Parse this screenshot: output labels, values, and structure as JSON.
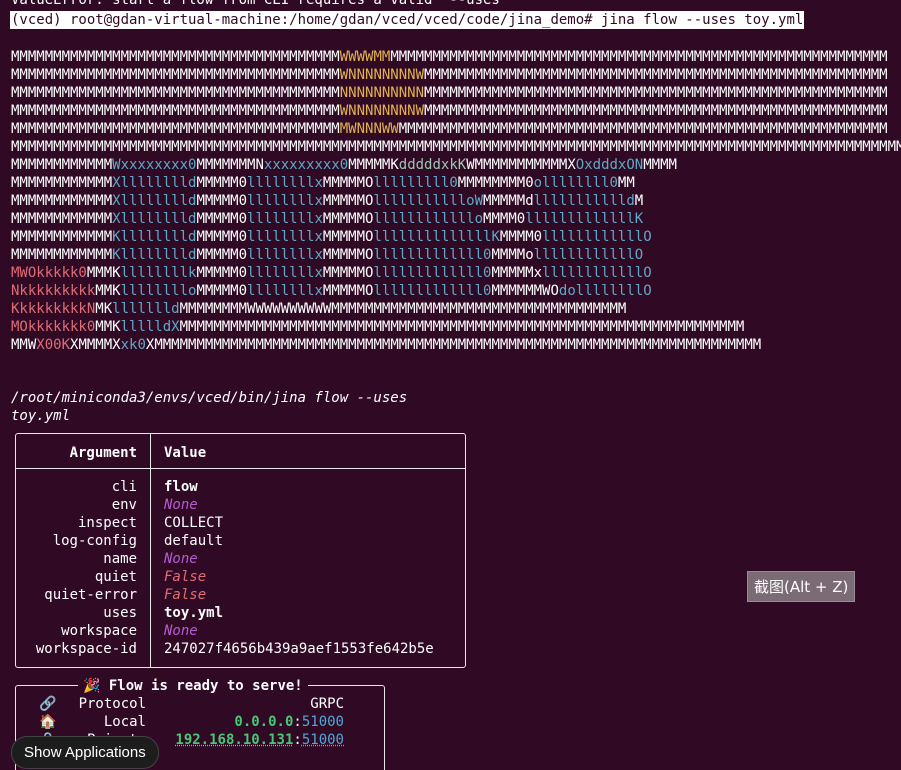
{
  "terminal": {
    "cut_line": "ValueError: start a flow from CLI requires a valid  --uses",
    "prompt": "(vced) root@gdan-virtual-machine:/home/gdan/vced/vced/code/jina_demo# jina flow --uses toy.yml",
    "ascii_art": [
      [
        [
          "w",
          "MMMMMMMMMMMMMMMMMMMMMMMMMMMMMMMMMMMMMMM"
        ],
        [
          "y",
          "WWWWMM"
        ],
        [
          "w",
          "MMMMMMMMMMMMMMMMMMMMMMMMMMMMMMMMMMMMMMMMMMMMMMMMMMMMMMMMMMM"
        ]
      ],
      [
        [
          "w",
          "MMMMMMMMMMMMMMMMMMMMMMMMMMMMMMMMMMMMMMM"
        ],
        [
          "y",
          "WNNNNNNNNW"
        ],
        [
          "w",
          "MMMMMMMMMMMMMMMMMMMMMMMMMMMMMMMMMMMMMMMMMMMMMMMMMMMMMMM"
        ]
      ],
      [
        [
          "w",
          "MMMMMMMMMMMMMMMMMMMMMMMMMMMMMMMMMMMMMMM"
        ],
        [
          "y",
          "NNNNNNNNNN"
        ],
        [
          "w",
          "MMMMMMMMMMMMMMMMMMMMMMMMMMMMMMMMMMMMMMMMMMMMMMMMMMMMMMM"
        ]
      ],
      [
        [
          "w",
          "MMMMMMMMMMMMMMMMMMMMMMMMMMMMMMMMMMMMMMM"
        ],
        [
          "y",
          "WNNNNNNNNW"
        ],
        [
          "w",
          "MMMMMMMMMMMMMMMMMMMMMMMMMMMMMMMMMMMMMMMMMMMMMMMMMMMMMMM"
        ]
      ],
      [
        [
          "w",
          "MMMMMMMMMMMMMMMMMMMMMMMMMMMMMMMMMMMMMMM"
        ],
        [
          "y",
          "MWNNNWW"
        ],
        [
          "w",
          "MMMMMMMMMMMMMMMMMMMMMMMMMMMMMMMMMMMMMMMMMMMMMMMMMMMMMMMMMM"
        ]
      ],
      [
        [
          "w",
          "MMMMMMMMMMMMMMMMMMMMMMMMMMMMMMMMMMMMMMMMMMMMMMMMMMMMMMMMMMMMMMMMMMMMMMMMMMMMMMMMMMMMMMMMMMMMMMMMMMMMMMMMMMMM"
        ]
      ],
      [
        [
          "w",
          "MMMMMMMMMMMM"
        ],
        [
          "c",
          "Wxxxxxxxx0"
        ],
        [
          "w",
          "MMMMMMMN"
        ],
        [
          "c",
          "xxxxxxxxx0"
        ],
        [
          "w",
          "MMMMMK"
        ],
        [
          "g",
          "dddddxkK"
        ],
        [
          "w",
          "WMMMMMMMMMMMX"
        ],
        [
          "c",
          "OxdddxON"
        ],
        [
          "w",
          "MMMM"
        ]
      ],
      [
        [
          "w",
          "MMMMMMMMMMMM"
        ],
        [
          "c",
          "Xlllllllld"
        ],
        [
          "w",
          "MMMMM0"
        ],
        [
          "c",
          "llllllllx"
        ],
        [
          "w",
          "MMMMMO"
        ],
        [
          "c",
          "lllllllll0"
        ],
        [
          "w",
          "MMMMMMMM0"
        ],
        [
          "c",
          "ollllllll0"
        ],
        [
          "w",
          "MM"
        ]
      ],
      [
        [
          "w",
          "MMMMMMMMMMMM"
        ],
        [
          "c",
          "Xlllllllld"
        ],
        [
          "w",
          "MMMMM0"
        ],
        [
          "c",
          "llllllllx"
        ],
        [
          "w",
          "MMMMMO"
        ],
        [
          "c",
          "llllllllllloW"
        ],
        [
          "w",
          "MMMMMd"
        ],
        [
          "c",
          "llllllllllld"
        ],
        [
          "w",
          "M"
        ]
      ],
      [
        [
          "w",
          "MMMMMMMMMMMM"
        ],
        [
          "c",
          "Xlllllllld"
        ],
        [
          "w",
          "MMMMM0"
        ],
        [
          "c",
          "llllllllx"
        ],
        [
          "w",
          "MMMMMO"
        ],
        [
          "c",
          "llllllllllllo"
        ],
        [
          "w",
          "MMMM0"
        ],
        [
          "c",
          "lllllllllllllK"
        ]
      ],
      [
        [
          "w",
          "MMMMMMMMMMMM"
        ],
        [
          "c",
          "Klllllllld"
        ],
        [
          "w",
          "MMMMM0"
        ],
        [
          "c",
          "llllllllx"
        ],
        [
          "w",
          "MMMMMO"
        ],
        [
          "c",
          "llllllllllllllK"
        ],
        [
          "w",
          "MMMM0"
        ],
        [
          "c",
          "llllllllllllO"
        ]
      ],
      [
        [
          "w",
          "MMMMMMMMMMMM"
        ],
        [
          "c",
          "Klllllllld"
        ],
        [
          "w",
          "MMMMM0"
        ],
        [
          "c",
          "llllllllx"
        ],
        [
          "w",
          "MMMMMO"
        ],
        [
          "c",
          "lllllllllllll0"
        ],
        [
          "w",
          "MMMMo"
        ],
        [
          "c",
          "llllllllllllO"
        ]
      ],
      [
        [
          "r",
          "MWOkkkkk0"
        ],
        [
          "w",
          "MMMK"
        ],
        [
          "c",
          "llllllllk"
        ],
        [
          "w",
          "MMMMM0"
        ],
        [
          "c",
          "llllllllx"
        ],
        [
          "w",
          "MMMMMO"
        ],
        [
          "c",
          "lllllllllllll0"
        ],
        [
          "w",
          "MMMMMx"
        ],
        [
          "c",
          "llllllllllllO"
        ]
      ],
      [
        [
          "r",
          "Nkkkkkkkkk"
        ],
        [
          "w",
          "MMK"
        ],
        [
          "c",
          "llllllllo"
        ],
        [
          "w",
          "MMMMM0"
        ],
        [
          "c",
          "llllllllx"
        ],
        [
          "w",
          "MMMMMO"
        ],
        [
          "c",
          "lllllllllllll0"
        ],
        [
          "w",
          "MMMMMMWO"
        ],
        [
          "c",
          "dollllllllO"
        ]
      ],
      [
        [
          "r",
          "KkkkkkkkkN"
        ],
        [
          "w",
          "MK"
        ],
        [
          "c",
          "llllllld"
        ],
        [
          "w",
          "MMMMMMMMWWWWWWWWWWMMMMMMMMMMMMMMMMMMMMMMMMMMMMMMMMMMM"
        ]
      ],
      [
        [
          "r",
          "MOkkkkkkk0"
        ],
        [
          "w",
          "MMK"
        ],
        [
          "c",
          "llllldX"
        ],
        [
          "w",
          "MMMMMMMMMMMMMMMMMMMMMMMMMMMMMMMMMMMMMMMMMMMMMMMMMMMMMMMMMMMMMMMMMMM"
        ]
      ],
      [
        [
          "w",
          "MMW"
        ],
        [
          "r",
          "X00K"
        ],
        [
          "w",
          "XMMMMX"
        ],
        [
          "c",
          "xk0"
        ],
        [
          "w",
          "XMMMMMMMMMMMMMMMMMMMMMMMMMMMMMMMMMMMMMMMMMMMMMMMMMMMMMMMMMMMMMMMMMMMMMMMM"
        ]
      ]
    ],
    "command_line_1": "/root/miniconda3/envs/vced/bin/jina flow --uses",
    "command_line_2": "toy.yml"
  },
  "argument_table": {
    "header_argument": "Argument",
    "header_value": "Value",
    "rows": [
      {
        "key": "cli",
        "value": "flow",
        "style": "bold"
      },
      {
        "key": "env",
        "value": "None",
        "style": "none"
      },
      {
        "key": "inspect",
        "value": "COLLECT",
        "style": "plain"
      },
      {
        "key": "log-config",
        "value": "default",
        "style": "plain"
      },
      {
        "key": "name",
        "value": "None",
        "style": "none"
      },
      {
        "key": "quiet",
        "value": "False",
        "style": "false"
      },
      {
        "key": "quiet-error",
        "value": "False",
        "style": "false"
      },
      {
        "key": "uses",
        "value": "toy.yml",
        "style": "bold"
      },
      {
        "key": "workspace",
        "value": "None",
        "style": "none"
      },
      {
        "key": "workspace-id",
        "value": "247027f4656b439a9aef1553fe642b5e",
        "style": "plain"
      }
    ]
  },
  "ready_panel": {
    "title_icon": "🎉",
    "title": "Flow is ready to serve!",
    "rows": [
      {
        "icon": "🔗",
        "icon_name": "link-icon",
        "key": "Protocol",
        "value_host": "GRPC",
        "value_port": "",
        "style": "plain"
      },
      {
        "icon": "🏠",
        "icon_name": "house-icon",
        "key": "Local",
        "value_host": "0.0.0.0",
        "value_port": "51000",
        "style": "addr"
      },
      {
        "icon": "🔒",
        "icon_name": "lock-icon",
        "key": "Private",
        "value_host": "192.168.10.131",
        "value_port": "51000",
        "style": "addr"
      }
    ]
  },
  "overlays": {
    "screenshot_tip": "截图(Alt + Z)",
    "show_applications": "Show Applications"
  }
}
